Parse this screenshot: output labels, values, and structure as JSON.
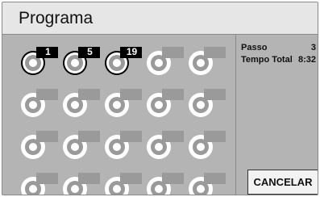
{
  "header": {
    "title": "Programa"
  },
  "info": {
    "step_label": "Passo",
    "step_value": "3",
    "total_label": "Tempo Total",
    "total_value": "8:32"
  },
  "tracks": [
    {
      "number": "1",
      "selected": true
    },
    {
      "number": "5",
      "selected": true
    },
    {
      "number": "19",
      "selected": true
    },
    {
      "number": "",
      "selected": false
    },
    {
      "number": "",
      "selected": false
    },
    {
      "number": "",
      "selected": false
    },
    {
      "number": "",
      "selected": false
    },
    {
      "number": "",
      "selected": false
    },
    {
      "number": "",
      "selected": false
    },
    {
      "number": "",
      "selected": false
    },
    {
      "number": "",
      "selected": false
    },
    {
      "number": "",
      "selected": false
    },
    {
      "number": "",
      "selected": false
    },
    {
      "number": "",
      "selected": false
    },
    {
      "number": "",
      "selected": false
    },
    {
      "number": "",
      "selected": false
    },
    {
      "number": "",
      "selected": false
    },
    {
      "number": "",
      "selected": false
    },
    {
      "number": "",
      "selected": false
    },
    {
      "number": "",
      "selected": false
    }
  ],
  "buttons": {
    "cancel": "CANCELAR"
  },
  "colors": {
    "panel": "#b4b4b4",
    "titlebar": "#e6e6e6",
    "selected_tab": "#000000",
    "empty_tab": "#9a9a9a"
  }
}
